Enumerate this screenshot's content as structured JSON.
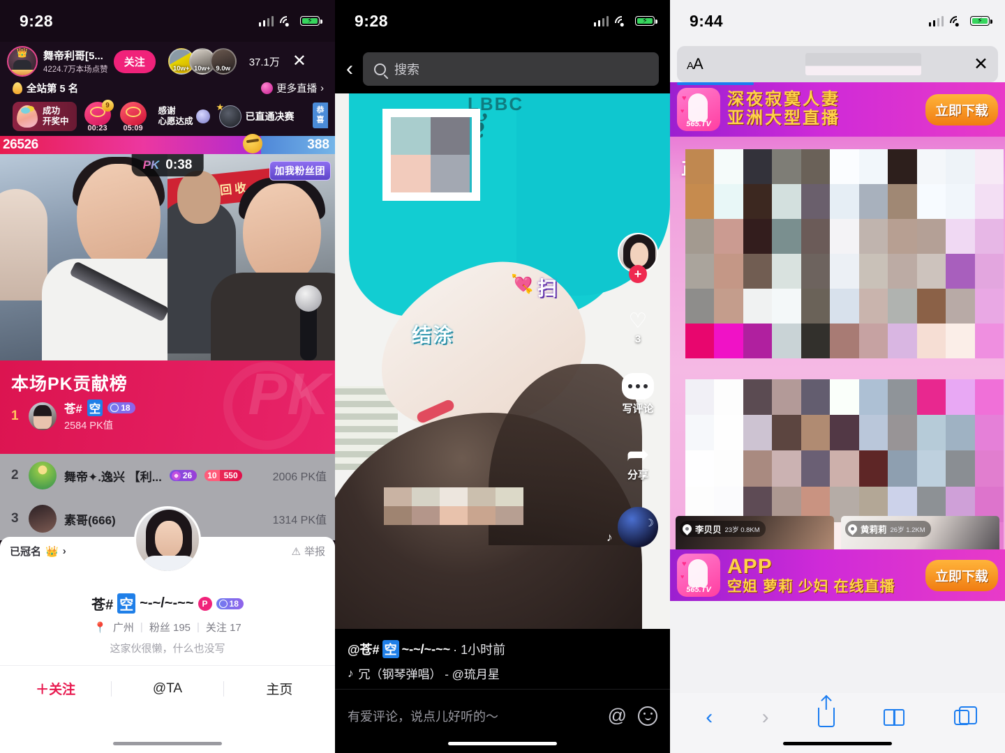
{
  "panels": {
    "live": {
      "status": {
        "time": "9:28"
      },
      "anchor": {
        "name": "舞帝利哥[5...",
        "likes": "4224.7万本场点赞",
        "follow_label": "关注",
        "viewers": "37.1万",
        "close_icon": "close-icon"
      },
      "top_fans": [
        {
          "count": "10w+"
        },
        {
          "count": "10w+"
        },
        {
          "count": "9.0w"
        }
      ],
      "rank": {
        "label": "全站第 5 名",
        "more_live": "更多直播"
      },
      "badges": {
        "lottery": {
          "line1": "成功",
          "line2": "开奖中"
        },
        "gift1": {
          "timer": "00:23",
          "count": "9"
        },
        "gift2": {
          "timer": "05:09"
        },
        "wish": {
          "line1": "感谢",
          "line2": "心愿达成"
        },
        "finals": "已直通决赛",
        "congrats": "恭喜"
      },
      "pk": {
        "left_score": "26526",
        "right_score": "388",
        "timer": "0:38",
        "pk_label": "PK",
        "fans_tag": "加我粉丝团",
        "banner_text": "垃圾回收"
      },
      "board": {
        "title": "本场PK贡献榜",
        "top": {
          "rank": "1",
          "name_pre": "苍#",
          "name_hl": "空",
          "level": "18",
          "value": "2584 PK值"
        },
        "rows": [
          {
            "rank": "2",
            "name": "舞帝✦.逸兴 【利...",
            "badge_a": "26",
            "badge_b1": "10",
            "badge_b2": "550",
            "value": "2006 PK值"
          },
          {
            "rank": "3",
            "name": "素哥(666)",
            "value": "1314 PK值"
          }
        ]
      },
      "profile": {
        "crowned": "已冠名",
        "report": "举报",
        "name_pre": "苍#",
        "name_hl": "空",
        "name_post": "~-~/~-~~",
        "p_badge": "P",
        "level": "18",
        "city": "广州",
        "fans": "粉丝 195",
        "following": "关注 17",
        "bio": "这家伙很懒，什么也没写",
        "actions": {
          "follow": "＋关注",
          "at": "@TA",
          "home": "主页"
        }
      }
    },
    "video": {
      "status": {
        "time": "9:28"
      },
      "search": {
        "placeholder": "搜索",
        "icon": "search-icon",
        "back_icon": "back-chevron-icon"
      },
      "stickers": {
        "a": "结涂",
        "b": "扫",
        "heart": "💘"
      },
      "rail": {
        "like_count": "3",
        "comment_label": "写评论",
        "share_label": "分享",
        "plus": "+"
      },
      "meta": {
        "author_pre": "@苍#",
        "author_hl": "空",
        "author_post": "~-~/~-~~",
        "time": "· 1小时前",
        "music": "冗（钢琴弹唱） - @琉月星"
      },
      "comment": {
        "placeholder": "有爱评论，说点儿好听的～",
        "at_icon": "@",
        "emoji_icon": "smiley-icon"
      }
    },
    "browser": {
      "status": {
        "time": "9:44"
      },
      "addressbar": {
        "aa_label": "AA",
        "stop_icon": "close-icon"
      },
      "ad_top": {
        "line1": "深夜寂寞人妻",
        "line2": "亚洲大型直播",
        "button": "立即下载",
        "logo": "565.TV"
      },
      "page": {
        "title": "正在直播中"
      },
      "cards": [
        {
          "name": "李贝贝",
          "detail": "23岁 0.8KM"
        },
        {
          "name": "黄莉莉",
          "detail": "26岁 1.2KM"
        }
      ],
      "ad_bottom": {
        "line1": "APP",
        "line2": "空姐 萝莉 少妇 在线直播",
        "button": "立即下载",
        "logo": "565.TV"
      },
      "toolbar": {
        "back_icon": "chevron-left-icon",
        "forward_icon": "chevron-right-icon",
        "share_icon": "share-icon",
        "bookmarks_icon": "book-icon",
        "tabs_icon": "tabs-icon"
      }
    }
  },
  "colors": {
    "pink_accent": "#f0227a",
    "safari_blue": "#1a7cf0",
    "ad_orange": "#f07c12",
    "pk_red": "#dc1450"
  }
}
